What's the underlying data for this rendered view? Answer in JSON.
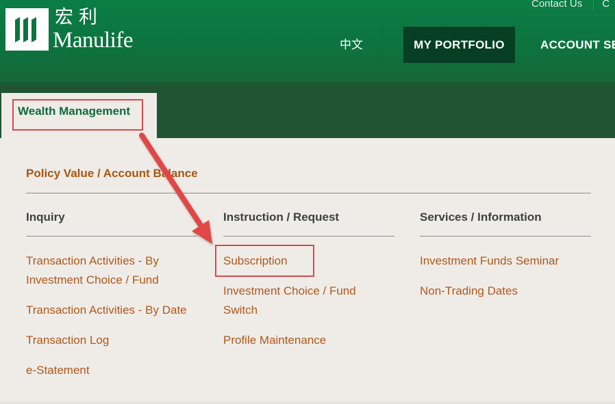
{
  "header": {
    "logo": {
      "chinese_name": "宏利",
      "english_name": "Manulife",
      "icon": "manulife-logo-icon"
    },
    "utility_links": [
      "Contact Us",
      "C"
    ],
    "language_toggle": "中文",
    "nav": [
      {
        "label": "MY PORTFOLIO",
        "active": true
      },
      {
        "label": "ACCOUNT SE",
        "active": false
      }
    ],
    "colors": {
      "header_green": "#0a7d45",
      "active_nav": "#063f24",
      "tab_bar": "#215433"
    }
  },
  "tabs": [
    {
      "label": "Wealth Management",
      "active": true
    }
  ],
  "menu": {
    "section_title": "Policy Value / Account Balance",
    "columns": [
      {
        "heading": "Inquiry",
        "links": [
          "Transaction Activities - By Investment Choice / Fund",
          "Transaction Activities - By Date",
          "Transaction Log",
          "e-Statement"
        ]
      },
      {
        "heading": "Instruction / Request",
        "links": [
          "Subscription",
          "Investment Choice / Fund Switch",
          "Profile Maintenance"
        ]
      },
      {
        "heading": "Services / Information",
        "links": [
          "Investment Funds Seminar",
          "Non-Trading Dates"
        ]
      }
    ],
    "colors": {
      "link": "#b0581a",
      "heading": "#3a4144",
      "section_title": "#a9560f"
    }
  },
  "annotations": {
    "highlight_color": "#d9484a",
    "highlighted": [
      "Wealth Management",
      "Subscription"
    ],
    "arrow": {
      "from": "Wealth Management",
      "to": "Subscription"
    }
  }
}
